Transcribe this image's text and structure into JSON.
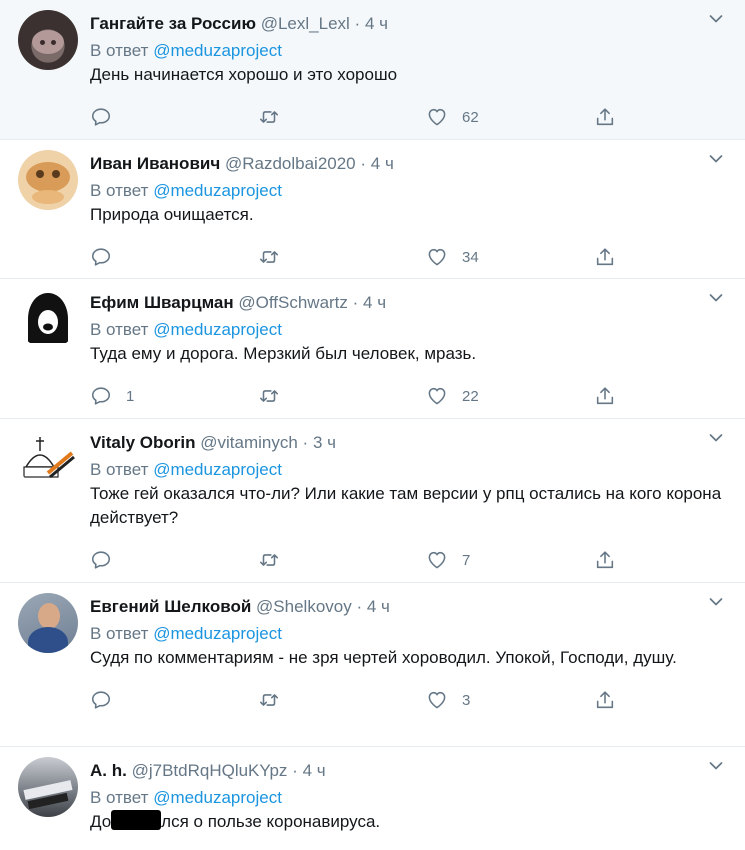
{
  "tweets": [
    {
      "name": "Гангайте за Россию",
      "handle": "@Lexl_Lexl",
      "time": "4 ч",
      "reply_prefix": "В ответ",
      "reply_to": "@meduzaproject",
      "text": "День начинается хорошо и это хорошо",
      "replies": "",
      "likes": "62",
      "highlighted": true
    },
    {
      "name": "Иван Иванович",
      "handle": "@Razdolbai2020",
      "time": "4 ч",
      "reply_prefix": "В ответ",
      "reply_to": "@meduzaproject",
      "text": "Природа очищается.",
      "replies": "",
      "likes": "34"
    },
    {
      "name": "Ефим Шварцман",
      "handle": "@OffSchwartz",
      "time": "4 ч",
      "reply_prefix": "В ответ",
      "reply_to": "@meduzaproject",
      "text": "Туда ему и дорога. Мерзкий был человек, мразь.",
      "replies": "1",
      "likes": "22"
    },
    {
      "name": "Vitaly Oborin",
      "handle": "@vitaminych",
      "time": "3 ч",
      "reply_prefix": "В ответ",
      "reply_to": "@meduzaproject",
      "text": "Тоже гей оказался что-ли? Или какие там версии у рпц остались на кого корона действует?",
      "replies": "",
      "likes": "7"
    },
    {
      "name": "Евгений Шелковой",
      "handle": "@Shelkovoy",
      "time": "4 ч",
      "reply_prefix": "В ответ",
      "reply_to": "@meduzaproject",
      "text": "Судя по комментариям - не зря чертей хороводил.  Упокой, Господи, душу.",
      "replies": "",
      "likes": "3"
    },
    {
      "name": "A. h.",
      "handle": "@j7BtdRqHQluKYpz",
      "time": "4 ч",
      "reply_prefix": "В ответ",
      "reply_to": "@meduzaproject",
      "text_start": "До",
      "text_end": "лся о пользе коронавируса."
    }
  ],
  "separator": "·",
  "colors": {
    "accent": "#1b95e0",
    "muted": "#657786",
    "text": "#14171a",
    "border": "#e6ecf0",
    "highlight_bg": "#f5f8fa"
  }
}
